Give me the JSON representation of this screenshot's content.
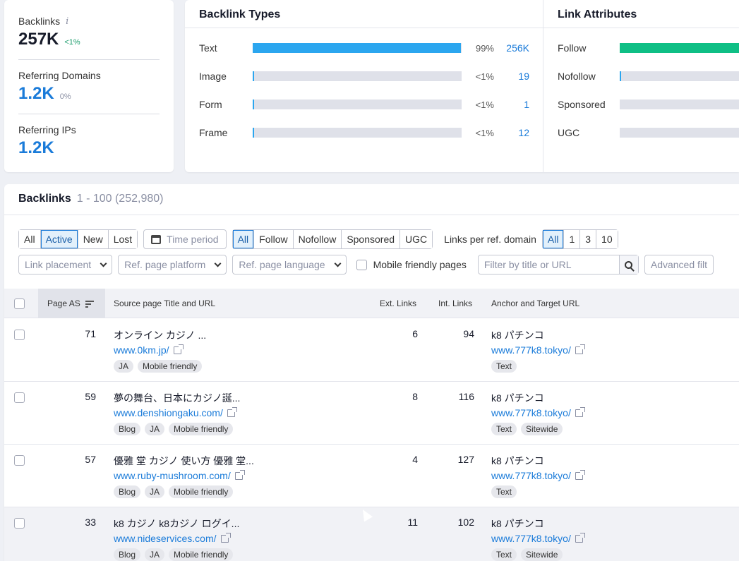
{
  "summary": {
    "backlinks": {
      "label": "Backlinks",
      "info": "i",
      "value": "257K",
      "delta": "<1%"
    },
    "referring_domains": {
      "label": "Referring Domains",
      "value": "1.2K",
      "delta": "0%"
    },
    "referring_ips": {
      "label": "Referring IPs",
      "value": "1.2K"
    }
  },
  "backlink_types": {
    "title": "Backlink Types",
    "rows": [
      {
        "label": "Text",
        "pct": "99%",
        "count": "256K",
        "fill": 0.995
      },
      {
        "label": "Image",
        "pct": "<1%",
        "count": "19",
        "fill": 0.006
      },
      {
        "label": "Form",
        "pct": "<1%",
        "count": "1",
        "fill": 0.006
      },
      {
        "label": "Frame",
        "pct": "<1%",
        "count": "12",
        "fill": 0.006
      }
    ]
  },
  "link_attributes": {
    "title": "Link Attributes",
    "rows": [
      {
        "label": "Follow",
        "fill": 1.0
      },
      {
        "label": "Nofollow",
        "fill": 0.01
      },
      {
        "label": "Sponsored",
        "fill": 0
      },
      {
        "label": "UGC",
        "fill": 0
      }
    ]
  },
  "table": {
    "title": "Backlinks",
    "range": "1 - 100 (252,980)",
    "status_filter": [
      "All",
      "Active",
      "New",
      "Lost"
    ],
    "time_period": "Time period",
    "type_filter": [
      "All",
      "Follow",
      "Nofollow",
      "Sponsored",
      "UGC"
    ],
    "links_per_label": "Links per ref. domain",
    "links_per_options": [
      "All",
      "1",
      "3",
      "10"
    ],
    "dropdowns": [
      "Link placement",
      "Ref. page platform",
      "Ref. page language"
    ],
    "mobile_label": "Mobile friendly pages",
    "search_placeholder": "Filter by title or URL",
    "advanced_label": "Advanced filt",
    "columns": {
      "page_as": "Page AS",
      "source": "Source page Title and URL",
      "ext": "Ext. Links",
      "int": "Int. Links",
      "anchor": "Anchor and Target URL"
    },
    "rows": [
      {
        "as": "71",
        "title": "オンライン カジノ ...",
        "url": "www.0km.jp/",
        "tags": [
          "JA",
          "Mobile friendly"
        ],
        "ext": "6",
        "int": "94",
        "anchor": "k8 パチンコ",
        "target": "www.777k8.tokyo/",
        "atags": [
          "Text"
        ]
      },
      {
        "as": "59",
        "title": "夢の舞台、日本にカジノ誕...",
        "url": "www.denshiongaku.com/",
        "tags": [
          "Blog",
          "JA",
          "Mobile friendly"
        ],
        "ext": "8",
        "int": "116",
        "anchor": "k8 パチンコ",
        "target": "www.777k8.tokyo/",
        "atags": [
          "Text",
          "Sitewide"
        ]
      },
      {
        "as": "57",
        "title": "優雅 堂 カジノ 使い方 優雅 堂...",
        "url": "www.ruby-mushroom.com/",
        "tags": [
          "Blog",
          "JA",
          "Mobile friendly"
        ],
        "ext": "4",
        "int": "127",
        "anchor": "k8 パチンコ",
        "target": "www.777k8.tokyo/",
        "atags": [
          "Text"
        ]
      },
      {
        "as": "33",
        "title": "k8 カジノ k8カジノ ログイ...",
        "url": "www.nideservices.com/",
        "tags": [
          "Blog",
          "JA",
          "Mobile friendly"
        ],
        "ext": "11",
        "int": "102",
        "anchor": "k8 パチンコ",
        "target": "www.777k8.tokyo/",
        "atags": [
          "Text",
          "Sitewide"
        ]
      }
    ]
  }
}
